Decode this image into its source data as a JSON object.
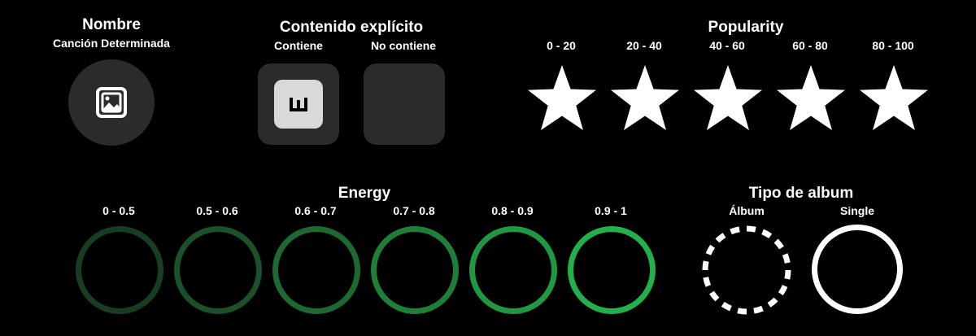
{
  "nombre": {
    "title": "Nombre",
    "subtitle": "Canción Determinada",
    "icon": "image-icon"
  },
  "explicito": {
    "title": "Contenido explícito",
    "contiene": "Contiene",
    "no_contiene": "No contiene",
    "explicit_icon": "explicit-e-icon"
  },
  "popularity": {
    "title": "Popularity",
    "ranges": [
      "0 - 20",
      "20 - 40",
      "40 - 60",
      "60 - 80",
      "80 - 100"
    ]
  },
  "energy": {
    "title": "Energy",
    "ranges": [
      "0 - 0.5",
      "0.5 - 0.6",
      "0.6 - 0.7",
      "0.7 - 0.8",
      "0.8 - 0.9",
      "0.9 - 1"
    ],
    "colors": [
      "#173d23",
      "#1b5129",
      "#1e6831",
      "#1e7f39",
      "#1f9841",
      "#21b049"
    ]
  },
  "tipo_album": {
    "title": "Tipo de album",
    "album": "Álbum",
    "single": "Single"
  }
}
